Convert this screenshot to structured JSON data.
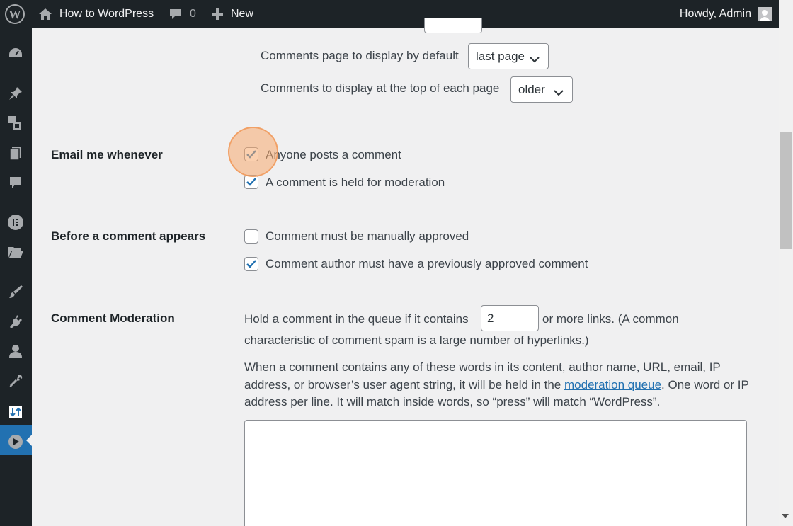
{
  "admin_bar": {
    "wp_logo_icon": "wordpress-logo-icon",
    "site_name": "How to WordPress",
    "site_icon": "home-icon",
    "comments_count": "0",
    "comments_icon": "comment-bubble-icon",
    "new_label": "New",
    "new_icon": "plus-icon",
    "howdy": "Howdy, Admin"
  },
  "side_menu": {
    "icons": [
      "dashboard-icon",
      "posts-pin-icon",
      "media-icon",
      "pages-icon",
      "comments-icon",
      "elementor-icon",
      "templates-folder-icon",
      "appearance-brush-icon",
      "plugins-icon",
      "users-icon",
      "tools-wrench-icon",
      "settings-icon",
      "media-play-icon"
    ],
    "active": "settings-icon"
  },
  "paging": {
    "default_page_label": "Comments page to display by default",
    "default_page_value": "last page",
    "top_label": "Comments to display at the top of each page",
    "top_value": "older"
  },
  "email": {
    "heading": "Email me whenever",
    "anyone_posts": {
      "label": "Anyone posts a comment",
      "checked": true
    },
    "held_for_moderation": {
      "label": "A comment is held for moderation",
      "checked": true
    }
  },
  "before_appears": {
    "heading": "Before a comment appears",
    "manually_approved": {
      "label": "Comment must be manually approved",
      "checked": false
    },
    "previously_approved": {
      "label": "Comment author must have a previously approved comment",
      "checked": true
    }
  },
  "moderation": {
    "heading": "Comment Moderation",
    "hold_prefix": "Hold a comment in the queue if it contains",
    "links_value": "2",
    "hold_suffix": "or more links. (A common",
    "hold_line2": "characteristic of comment spam is a large number of hyperlinks.)",
    "desc_part1": "When a comment contains any of these words in its content, author name, URL, email, IP address, or browser’s user agent string, it will be held in the ",
    "desc_link": "moderation queue",
    "desc_part2": ". One word or IP address per line. It will match inside words, so “press” will match “WordPress”.",
    "keys_value": ""
  },
  "colors": {
    "admin_dark": "#1d2327",
    "accent": "#2271b1",
    "background": "#f0f0f1",
    "click_marker": "#f8aa6e"
  }
}
